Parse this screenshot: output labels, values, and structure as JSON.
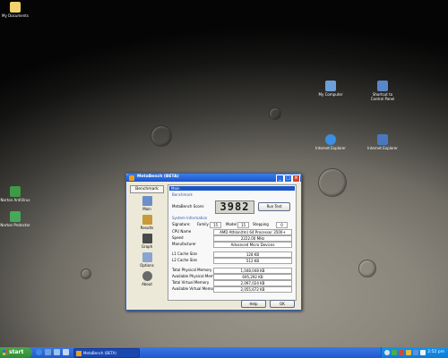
{
  "desktop": {
    "icons": [
      {
        "label": "My Documents"
      },
      {
        "label": "My Computer"
      },
      {
        "label": "Shortcut to Control Panel"
      },
      {
        "label": "Internet Explorer"
      },
      {
        "label": "Internet Explorer"
      },
      {
        "label": "Norton AntiVirus"
      },
      {
        "label": "Norton Protector"
      }
    ]
  },
  "window": {
    "title": "MetaBench (BETA)",
    "sidebar": {
      "top_button": "Benchmark",
      "items": [
        {
          "label": "Main",
          "icon": "main-icon"
        },
        {
          "label": "Results",
          "icon": "results-icon"
        },
        {
          "label": "Graph",
          "icon": "graph-icon"
        },
        {
          "label": "Options",
          "icon": "options-icon"
        },
        {
          "label": "About",
          "icon": "about-icon"
        }
      ]
    },
    "main": {
      "header": "Main",
      "benchmark_group": "Benchmark",
      "score_label": "MetaBench Score:",
      "score_value": "3982",
      "run_button": "Run Test",
      "sysinfo_group": "System Information",
      "signature_label": "Signature:",
      "family_label": "Family",
      "family_value": "15",
      "model_label": "Model",
      "model_value": "15",
      "stepping_label": "Stepping",
      "stepping_value": "0",
      "rows": [
        {
          "key": "CPU Name",
          "value": "AMD Athlon(tm) 64 Processor 3500+"
        },
        {
          "key": "Speed",
          "value": "2222.00 MHz"
        },
        {
          "key": "Manufacturer",
          "value": "Advanced Micro Devices"
        },
        {
          "key": "L1 Cache Size",
          "value": "128 KB"
        },
        {
          "key": "L2 Cache Size",
          "value": "512 KB"
        },
        {
          "key": "Total Physical Memory",
          "value": "1,048,048 KB"
        },
        {
          "key": "Available Physical Memory",
          "value": "695,292 KB"
        },
        {
          "key": "Total Virtual Memory",
          "value": "2,097,024 KB"
        },
        {
          "key": "Available Virtual Memory",
          "value": "2,055,672 KB"
        }
      ],
      "help_button": "Help",
      "ok_button": "OK"
    }
  },
  "taskbar": {
    "start_label": "start",
    "task_item": "MetaBench (BETA)",
    "clock": "2:52 pm"
  },
  "colors": {
    "titlebar": "#1c55cf",
    "taskbar": "#1f58d0",
    "start_button": "#2f8a36",
    "selection": "#1854c4"
  }
}
